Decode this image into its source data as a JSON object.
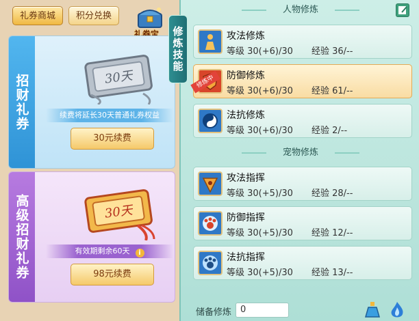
{
  "top_tabs": {
    "gift_mall": "礼券商城",
    "points_exchange": "积分兑换"
  },
  "coupon_treasure_label": "礼券宝",
  "cards": [
    {
      "side_title": "招财礼券",
      "art_text": "30天",
      "note": "续费将延长30天普通礼券权益",
      "button": "30元续费"
    },
    {
      "side_title": "高级招财礼券",
      "art_text": "30天",
      "note": "有效期剩余60天",
      "button": "98元续费"
    }
  ],
  "right": {
    "vertical_tab": "修炼技能",
    "sections": {
      "character": "人物修炼",
      "pet": "宠物修炼"
    },
    "skills": [
      {
        "name": "攻法修炼",
        "level": "等级  30(+6)/30",
        "exp": "经验  36/--",
        "icon": "warrior-figure-icon"
      },
      {
        "name": "防御修炼",
        "level": "等级  30(+6)/30",
        "exp": "经验  61/--",
        "icon": "shield-icon",
        "ribbon": "修炼中"
      },
      {
        "name": "法抗修炼",
        "level": "等级  30(+6)/30",
        "exp": "经验  2/--",
        "icon": "taiji-icon"
      },
      {
        "name": "攻法指挥",
        "level": "等级  30(+5)/30",
        "exp": "经验  28/--",
        "icon": "claw-attack-icon"
      },
      {
        "name": "防御指挥",
        "level": "等级  30(+5)/30",
        "exp": "经验  12/--",
        "icon": "paw-shield-icon"
      },
      {
        "name": "法抗指挥",
        "level": "等级  30(+5)/30",
        "exp": "经验  13/--",
        "icon": "paw-magic-icon"
      }
    ],
    "reserve": {
      "label": "储备修炼",
      "value": "0"
    }
  },
  "colors": {
    "accent_blue": "#2f93d6",
    "accent_purple": "#8f52c7",
    "active_row": "#f9dca3",
    "panel_teal": "#aedfd6"
  }
}
